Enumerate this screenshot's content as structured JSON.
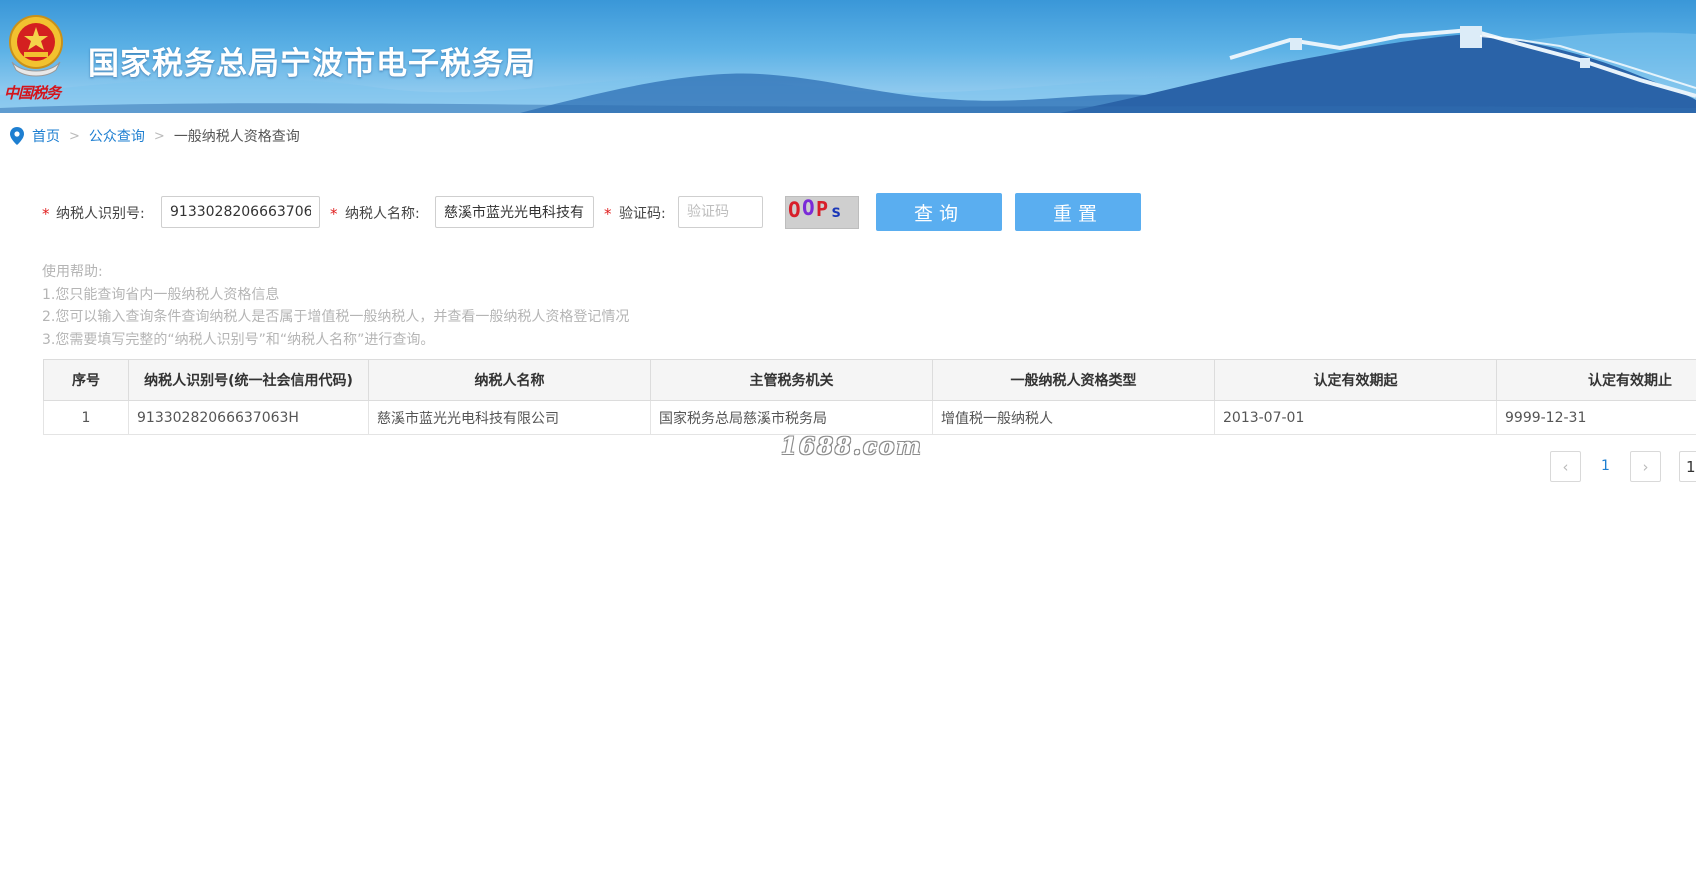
{
  "header": {
    "title": "国家税务总局宁波市电子税务局",
    "emblem_caption": "中国税务"
  },
  "breadcrumb": {
    "home": "首页",
    "section": "公众查询",
    "current": "一般纳税人资格查询",
    "separator": ">"
  },
  "search_form": {
    "required_mark": "*",
    "taxpayer_id_label": "纳税人识别号:",
    "taxpayer_id_value": "91330282066637063H",
    "taxpayer_name_label": "纳税人名称:",
    "taxpayer_name_value": "慈溪市蓝光光电科技有限公司",
    "captcha_label": "验证码:",
    "captcha_placeholder": "验证码",
    "captcha_image_text": "OOPs",
    "query_button": "查询",
    "reset_button": "重置"
  },
  "help": {
    "title": "使用帮助:",
    "lines": [
      "1.您只能查询省内一般纳税人资格信息",
      "2.您可以输入查询条件查询纳税人是否属于增值税一般纳税人，并查看一般纳税人资格登记情况",
      "3.您需要填写完整的“纳税人识别号”和“纳税人名称”进行查询。"
    ]
  },
  "results_table": {
    "columns": [
      "序号",
      "纳税人识别号(统一社会信用代码)",
      "纳税人名称",
      "主管税务机关",
      "一般纳税人资格类型",
      "认定有效期起",
      "认定有效期止"
    ],
    "rows": [
      [
        "1",
        "91330282066637063H",
        "慈溪市蓝光光电科技有限公司",
        "国家税务总局慈溪市税务局",
        "增值税一般纳税人",
        "2013-07-01",
        "9999-12-31"
      ]
    ]
  },
  "watermark": "1688.com",
  "pagination": {
    "prev_icon": "‹",
    "next_icon": "›",
    "current_page": "1",
    "page_input_value": "1"
  },
  "colors": {
    "accent_blue": "#1e7fd1",
    "button_blue": "#5aaef0",
    "required_red": "#e02020",
    "banner_top": "#3a97d8"
  }
}
